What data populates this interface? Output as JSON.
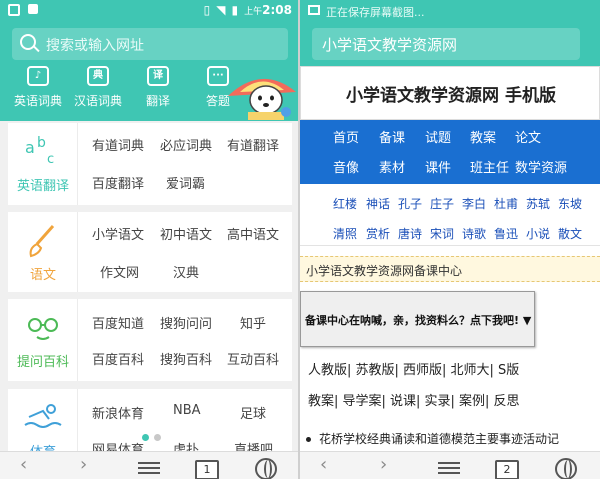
{
  "left_phone": {
    "status_bar": {
      "time": "2:08",
      "ampm": "上午"
    },
    "search": {
      "placeholder": "搜索或输入网址"
    },
    "quick_links": [
      {
        "label": "英语词典",
        "icon": "dictionary-icon"
      },
      {
        "label": "汉语词典",
        "icon": "chinese-dict-icon"
      },
      {
        "label": "翻译",
        "icon": "translate-icon"
      },
      {
        "label": "答题",
        "icon": "chat-answer-icon"
      }
    ],
    "cards": [
      {
        "category": "英语翻译",
        "icon": "abc-icon",
        "links": [
          "有道词典",
          "必应词典",
          "有道翻译",
          "百度翻译",
          "爱词霸"
        ]
      },
      {
        "category": "语文",
        "icon": "brush-icon",
        "links": [
          "小学语文",
          "初中语文",
          "高中语文",
          "作文网",
          "汉典"
        ]
      },
      {
        "category": "提问百科",
        "icon": "glasses-face-icon",
        "links": [
          "百度知道",
          "搜狗问问",
          "知乎",
          "百度百科",
          "搜狗百科",
          "互动百科"
        ]
      },
      {
        "category": "体育",
        "icon": "swimmer-icon",
        "links": [
          "新浪体育",
          "NBA",
          "足球",
          "网易体育",
          "虎扑",
          "直播吧"
        ]
      }
    ],
    "page_indicator": {
      "pages": 2,
      "active": 1
    },
    "bottom_nav": {
      "tab_count": "1"
    }
  },
  "right_phone": {
    "status_text": "正在保存屏幕截图...",
    "url_bar": "小学语文教学资源网",
    "page_title": "小学语文教学资源网 手机版",
    "blue_nav": [
      [
        "首页",
        "备课",
        "试题",
        "教案",
        "论文"
      ],
      [
        "音像",
        "素材",
        "课件",
        "班主任",
        "数学资源"
      ]
    ],
    "name_links": [
      [
        "红楼",
        "神话",
        "孔子",
        "庄子",
        "李白",
        "杜甫",
        "苏轼",
        "东坡"
      ],
      [
        "清照",
        "赏析",
        "唐诗",
        "宋词",
        "诗歌",
        "鲁迅",
        "小说",
        "散文"
      ]
    ],
    "center_heading": "小学语文教学资源网备课中心",
    "cta": "备课中心在呐喊，亲，找资料么？点下我吧! ▼",
    "editions": [
      "人教版| 苏教版| 西师版| 北师大| S版",
      "教案| 导学案| 说课| 实录| 案例| 反思"
    ],
    "bullet_item": "花桥学校经典诵读和道德模范主要事迹活动记",
    "bottom_nav": {
      "tab_count": "2"
    }
  },
  "colors": {
    "teal": "#3fc6b3",
    "blue_nav": "#1a6fd1",
    "link_blue": "#1a4fb8",
    "orange": "#f0a43c",
    "green": "#4cba56"
  }
}
